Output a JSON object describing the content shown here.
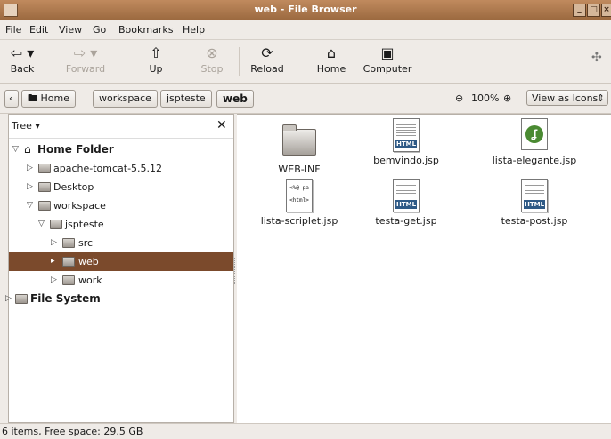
{
  "window": {
    "title": "web - File Browser"
  },
  "menu": [
    "File",
    "Edit",
    "View",
    "Go",
    "Bookmarks",
    "Help"
  ],
  "toolbar": {
    "back": "Back",
    "forward": "Forward",
    "up": "Up",
    "stop": "Stop",
    "reload": "Reload",
    "home": "Home",
    "computer": "Computer"
  },
  "location": {
    "crumbs": [
      "Home",
      "workspace",
      "jspteste",
      "web"
    ],
    "zoom": "100%",
    "view": "View as Icons"
  },
  "sidebar": {
    "title": "Tree",
    "items": [
      {
        "label": "Home Folder"
      },
      {
        "label": "apache-tomcat-5.5.12"
      },
      {
        "label": "Desktop"
      },
      {
        "label": "workspace"
      },
      {
        "label": "jspteste"
      },
      {
        "label": "src"
      },
      {
        "label": "web"
      },
      {
        "label": "work"
      },
      {
        "label": "File System"
      }
    ]
  },
  "files": [
    {
      "name": "WEB-INF"
    },
    {
      "name": "bemvindo.jsp"
    },
    {
      "name": "lista-elegante.jsp"
    },
    {
      "name": "lista-scriplet.jsp"
    },
    {
      "name": "testa-get.jsp"
    },
    {
      "name": "testa-post.jsp"
    }
  ],
  "status": {
    "text": "6 items, Free space: 29.5 GB"
  },
  "colors": {
    "accent": "#7b4a2c",
    "titlebar": "#9c6a40"
  }
}
